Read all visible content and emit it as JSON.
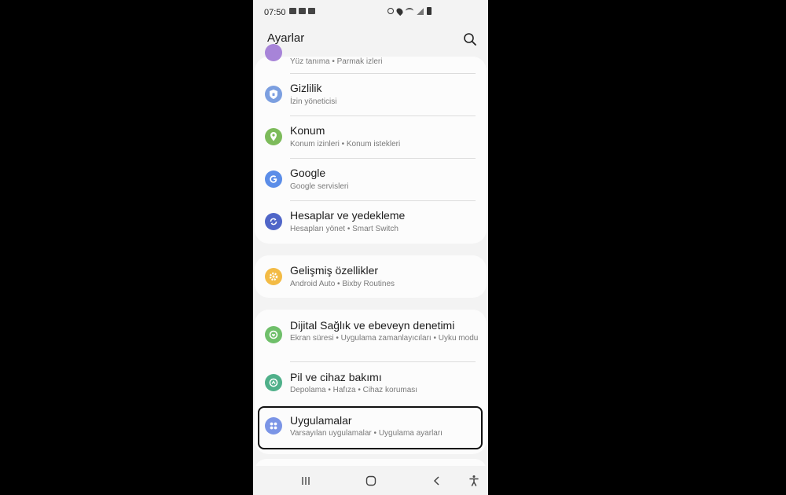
{
  "status": {
    "time": "07:50"
  },
  "header": {
    "title": "Ayarlar"
  },
  "colors": {
    "privacy": "#7c9fe0",
    "location": "#7dbb5b",
    "google": "#5b8de8",
    "accounts": "#5066c8",
    "advanced": "#f3bb45",
    "wellbeing": "#6fbf6a",
    "battery": "#4fb08a",
    "apps": "#7b95e6"
  },
  "groups": [
    {
      "items": [
        {
          "title": "",
          "subtitle": "Yüz tanıma  •  Parmak izleri"
        },
        {
          "title": "Gizlilik",
          "subtitle": "İzin yöneticisi",
          "icon": "shield-icon"
        },
        {
          "title": "Konum",
          "subtitle": "Konum izinleri  •  Konum istekleri",
          "icon": "location-icon"
        },
        {
          "title": "Google",
          "subtitle": "Google servisleri",
          "icon": "google-icon"
        },
        {
          "title": "Hesaplar ve yedekleme",
          "subtitle": "Hesapları yönet  •  Smart Switch",
          "icon": "sync-icon"
        }
      ]
    },
    {
      "items": [
        {
          "title": "Gelişmiş özellikler",
          "subtitle": "Android Auto  •  Bixby Routines",
          "icon": "gear-plus-icon"
        }
      ]
    },
    {
      "items": [
        {
          "title": "Dijital Sağlık ve ebeveyn denetimi",
          "subtitle": "Ekran süresi  •  Uygulama zamanlayıcıları  •  Uyku modu",
          "icon": "wellbeing-icon"
        },
        {
          "title": "Pil ve cihaz bakımı",
          "subtitle": "Depolama  •  Hafıza  •  Cihaz koruması",
          "icon": "device-care-icon"
        },
        {
          "title": "Uygulamalar",
          "subtitle": "Varsayılan uygulamalar  •  Uygulama ayarları",
          "icon": "apps-grid-icon"
        }
      ]
    }
  ],
  "nav": {
    "recents": "recents-icon",
    "home": "home-icon",
    "back": "back-icon",
    "accessibility": "accessibility-icon"
  }
}
